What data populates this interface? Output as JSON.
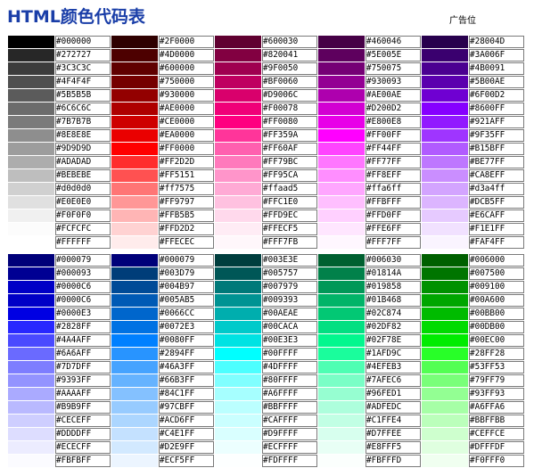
{
  "page": {
    "title": "HTML颜色代码表",
    "ad_label": "广告位"
  },
  "table": {
    "blocks": [
      [
        [
          "#000000",
          "#2F0000",
          "#600030",
          "#460046",
          "#28004D"
        ],
        [
          "#272727",
          "#4D0000",
          "#820041",
          "#5E005E",
          "#3A006F"
        ],
        [
          "#3C3C3C",
          "#600000",
          "#9F0050",
          "#750075",
          "#4B0091"
        ],
        [
          "#4F4F4F",
          "#750000",
          "#BF0060",
          "#930093",
          "#5B00AE"
        ],
        [
          "#5B5B5B",
          "#930000",
          "#D9006C",
          "#AE00AE",
          "#6F00D2"
        ],
        [
          "#6C6C6C",
          "#AE0000",
          "#F00078",
          "#D200D2",
          "#8600FF"
        ],
        [
          "#7B7B7B",
          "#CE0000",
          "#FF0080",
          "#E800E8",
          "#921AFF"
        ],
        [
          "#8E8E8E",
          "#EA0000",
          "#FF359A",
          "#FF00FF",
          "#9F35FF"
        ],
        [
          "#9D9D9D",
          "#FF0000",
          "#FF60AF",
          "#FF44FF",
          "#B15BFF"
        ],
        [
          "#ADADAD",
          "#FF2D2D",
          "#FF79BC",
          "#FF77FF",
          "#BE77FF"
        ],
        [
          "#BEBEBE",
          "#FF5151",
          "#FF95CA",
          "#FF8EFF",
          "#CA8EFF"
        ],
        [
          "#d0d0d0",
          "#ff7575",
          "#ffaad5",
          "#ffa6ff",
          "#d3a4ff"
        ],
        [
          "#E0E0E0",
          "#FF9797",
          "#FFC1E0",
          "#FFBFFF",
          "#DCB5FF"
        ],
        [
          "#F0F0F0",
          "#FFB5B5",
          "#FFD9EC",
          "#FFD0FF",
          "#E6CAFF"
        ],
        [
          "#FCFCFC",
          "#FFD2D2",
          "#FFECF5",
          "#FFE6FF",
          "#F1E1FF"
        ],
        [
          "#FFFFFF",
          "#FFECEC",
          "#FFF7FB",
          "#FFF7FF",
          "#FAF4FF"
        ]
      ],
      [
        [
          "#000079",
          "#000079",
          "#003E3E",
          "#006030",
          "#006000"
        ],
        [
          "#000093",
          "#003D79",
          "#005757",
          "#01814A",
          "#007500"
        ],
        [
          "#0000C6",
          "#004B97",
          "#007979",
          "#019858",
          "#009100"
        ],
        [
          "#0000C6",
          "#005AB5",
          "#009393",
          "#01B468",
          "#00A600"
        ],
        [
          "#0000E3",
          "#0066CC",
          "#00AEAE",
          "#02C874",
          "#00BB00"
        ],
        [
          "#2828FF",
          "#0072E3",
          "#00CACA",
          "#02DF82",
          "#00DB00"
        ],
        [
          "#4A4AFF",
          "#0080FF",
          "#00E3E3",
          "#02F78E",
          "#00EC00"
        ],
        [
          "#6A6AFF",
          "#2894FF",
          "#00FFFF",
          "#1AFD9C",
          "#28FF28"
        ],
        [
          "#7D7DFF",
          "#46A3FF",
          "#4DFFFF",
          "#4EFEB3",
          "#53FF53"
        ],
        [
          "#9393FF",
          "#66B3FF",
          "#80FFFF",
          "#7AFEC6",
          "#79FF79"
        ],
        [
          "#AAAAFF",
          "#84C1FF",
          "#A6FFFF",
          "#96FED1",
          "#93FF93"
        ],
        [
          "#B9B9FF",
          "#97CBFF",
          "#BBFFFF",
          "#ADFEDC",
          "#A6FFA6"
        ],
        [
          "#CECEFF",
          "#ACD6FF",
          "#CAFFFF",
          "#C1FFE4",
          "#BBFFBB"
        ],
        [
          "#DDDDFF",
          "#C4E1FF",
          "#D9FFFF",
          "#D7FFEE",
          "#CEFFCE"
        ],
        [
          "#ECECFF",
          "#D2E9FF",
          "#ECFFFF",
          "#E8FFF5",
          "#DFFFDF"
        ],
        [
          "#FBFBFF",
          "#ECF5FF",
          "#FDFFFF",
          "#FBFFFD",
          "#F0FFF0"
        ]
      ]
    ]
  }
}
